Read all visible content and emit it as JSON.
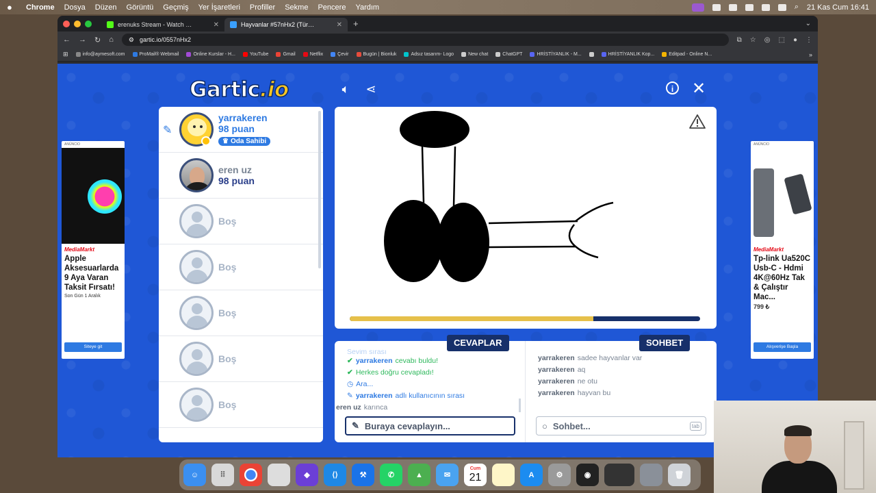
{
  "menubar": {
    "app": "Chrome",
    "items": [
      "Dosya",
      "Düzen",
      "Görüntü",
      "Geçmiş",
      "Yer İşaretleri",
      "Profiller",
      "Sekme",
      "Pencere",
      "Yardım"
    ],
    "datetime": "21 Kas Cum  16:41"
  },
  "browser": {
    "tabs": [
      {
        "title": "erenuks Stream - Watch Live",
        "active": false,
        "favicon_color": "#53fc18"
      },
      {
        "title": "Hayvanlar #57nHx2 (Türkçe)",
        "active": true,
        "favicon_color": "#3aa0ff"
      }
    ],
    "url": "gartic.io/0557nHx2",
    "bookmarks": [
      {
        "label": "info@aymesoft.com",
        "color": "#888"
      },
      {
        "label": "ProMail® Webmail",
        "color": "#2e7ae2"
      },
      {
        "label": "Online Kurslar - H...",
        "color": "#a24bd6"
      },
      {
        "label": "YouTube",
        "color": "#ff0000"
      },
      {
        "label": "Gmail",
        "color": "#ea4335"
      },
      {
        "label": "Netflix",
        "color": "#e50914"
      },
      {
        "label": "Çevir",
        "color": "#4285f4"
      },
      {
        "label": "Bugün | Bionluk",
        "color": "#e74c3c"
      },
      {
        "label": "Adsız tasarım- Logo",
        "color": "#00c4cc"
      },
      {
        "label": "New chat",
        "color": "#ccc"
      },
      {
        "label": "ChatGPT",
        "color": "#ccc"
      },
      {
        "label": "HRİSTİYANLIK - M...",
        "color": "#5865f2"
      },
      {
        "label": "",
        "color": "#ccc"
      },
      {
        "label": "HRİSTİYANLIK Kop...",
        "color": "#5865f2"
      },
      {
        "label": "Editpad - Online N...",
        "color": "#f4b400"
      }
    ]
  },
  "game": {
    "logo_main": "Gartic",
    "logo_suffix": ".io",
    "players": [
      {
        "name": "yarrakeren",
        "points": "98 puan",
        "badge": "Oda Sahibi",
        "avatar": "yellow",
        "drawing": true
      },
      {
        "name": "eren uz",
        "points": "98 puan",
        "avatar": "photo"
      },
      {
        "empty": "Boş"
      },
      {
        "empty": "Boş"
      },
      {
        "empty": "Boş"
      },
      {
        "empty": "Boş"
      },
      {
        "empty": "Boş"
      }
    ],
    "timer_progress": 0.695,
    "answers": {
      "title": "CEVAPLAR",
      "messages": [
        {
          "type": "faded",
          "text": "Sevim sırası"
        },
        {
          "type": "green",
          "name": "yarrakeren",
          "text": "cevabı buldu!"
        },
        {
          "type": "green",
          "name": "",
          "text": "Herkes doğru cevapladı!"
        },
        {
          "type": "blue-clock",
          "name": "",
          "text": "Ara..."
        },
        {
          "type": "blue-pencil",
          "name": "yarrakeren",
          "text": "adlı kullanıcının sırası"
        },
        {
          "type": "plain",
          "name": "eren uz",
          "text": "karınca"
        }
      ],
      "placeholder": "Buraya cevaplayın..."
    },
    "chat": {
      "title": "SOHBET",
      "messages": [
        {
          "name": "yarrakeren",
          "text": "sadee hayvanlar var"
        },
        {
          "name": "yarrakeren",
          "text": "aq"
        },
        {
          "name": "yarrakeren",
          "text": "ne otu"
        },
        {
          "name": "yarrakeren",
          "text": "hayvan bu"
        }
      ],
      "placeholder": "Sohbet...",
      "tab_key": "tab"
    }
  },
  "ads": {
    "left": {
      "label": "ANÜNCIO",
      "brand": "MediaMarkt",
      "title": "Apple Aksesuarlarda 9 Aya Varan Taksit Fırsatı!",
      "sub": "Son Gün 1 Aralık",
      "button": "Siteye git"
    },
    "right": {
      "label": "ANÜNCIO",
      "brand": "MediaMarkt",
      "title": "Tp-link Ua520C Usb-C - Hdmi 4K@60Hz Tak & Çalıştır Mac...",
      "price": "799 ₺",
      "button": "Alışverişe Başla"
    }
  },
  "dock": {
    "calendar_month": "Cum",
    "calendar_day": "21"
  }
}
